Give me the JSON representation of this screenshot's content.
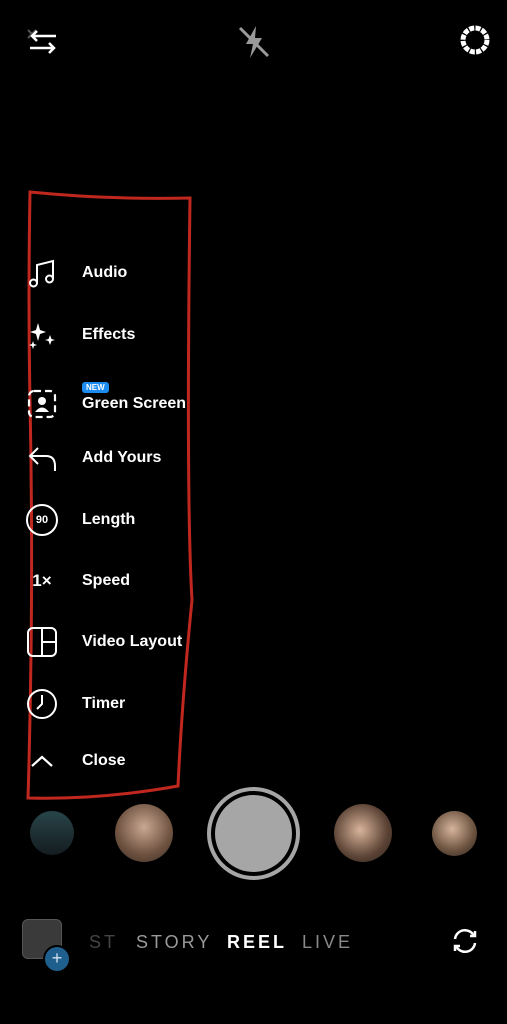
{
  "top_bar": {
    "icons": [
      "swap-arrows-icon",
      "flash-off-icon",
      "settings-gear-icon"
    ]
  },
  "menu": {
    "items": [
      {
        "label": "Audio",
        "icon": "music-note-icon"
      },
      {
        "label": "Effects",
        "icon": "sparkles-icon"
      },
      {
        "label": "Green Screen",
        "icon": "green-screen-icon",
        "badge": "NEW"
      },
      {
        "label": "Add Yours",
        "icon": "reply-arrow-icon"
      },
      {
        "label": "Length",
        "icon": "length-icon",
        "icon_text": "90"
      },
      {
        "label": "Speed",
        "icon": "speed-icon",
        "icon_text": "1×"
      },
      {
        "label": "Video Layout",
        "icon": "layout-grid-icon"
      },
      {
        "label": "Timer",
        "icon": "clock-icon"
      },
      {
        "label": "Close",
        "icon": "chevron-up-icon"
      }
    ]
  },
  "modes": {
    "partial": "ST",
    "story": "STORY",
    "reel": "REEL",
    "live": "LIVE",
    "active": "REEL"
  },
  "colors": {
    "annotation": "#c0271f",
    "badge": "#1d8cf0",
    "shutter": "#a6a6a6"
  }
}
